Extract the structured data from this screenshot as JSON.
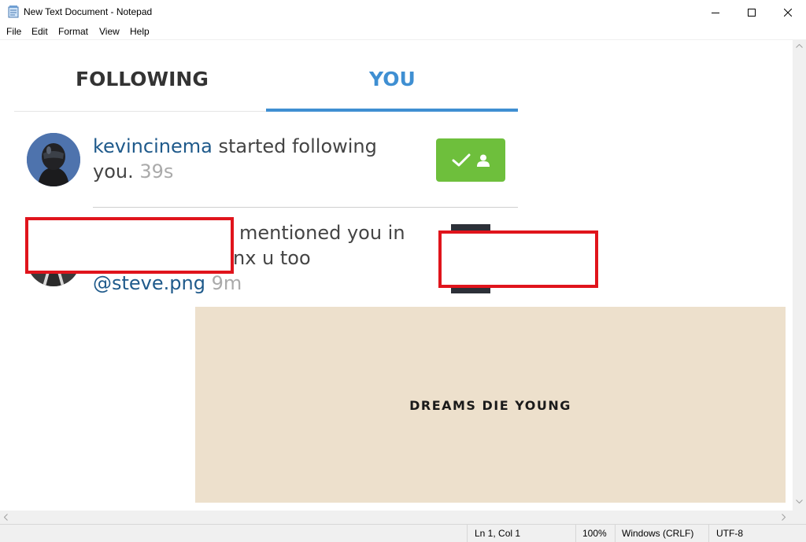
{
  "window": {
    "title": "New Text Document - Notepad",
    "icon": "notepad-icon"
  },
  "menu": [
    "File",
    "Edit",
    "Format",
    "View",
    "Help"
  ],
  "content": {
    "tabs": [
      {
        "label": "FOLLOWING",
        "active": false
      },
      {
        "label": "YOU",
        "active": true
      }
    ],
    "notifications": [
      {
        "username": "kevincinema",
        "action": " started following",
        "action_cont": "you.",
        "time": "39s",
        "button_icon": "check-user-icon"
      },
      {
        "line1": "mentioned you in",
        "line2": "nx u too",
        "mention": "@steve.png",
        "time": "9m"
      }
    ],
    "banner_text": "DREAMS DIE YOUNG",
    "accent": "#3f8fd2",
    "follow_color": "#6ebf3c",
    "banner_color": "#ede0cc",
    "redaction_color": "#e0141c"
  },
  "status": {
    "position": "Ln 1, Col 1",
    "zoom": "100%",
    "line_ending": "Windows (CRLF)",
    "encoding": "UTF-8"
  }
}
